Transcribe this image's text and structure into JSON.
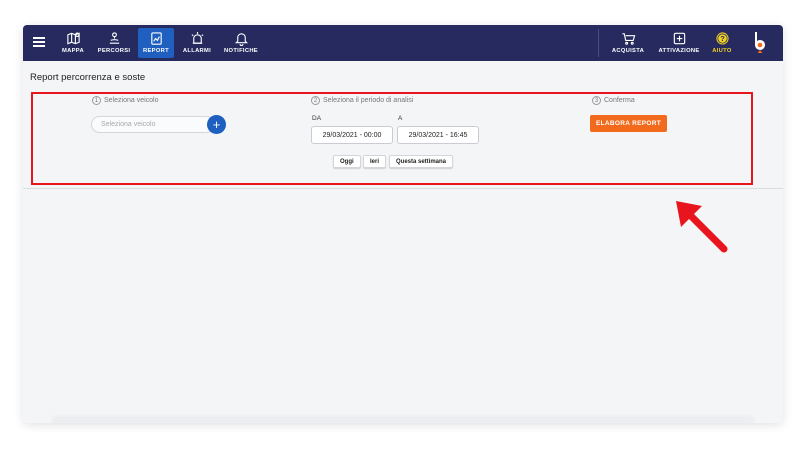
{
  "nav": {
    "items": [
      {
        "label": "MAPPA",
        "icon": "map-icon"
      },
      {
        "label": "PERCORSI",
        "icon": "route-icon"
      },
      {
        "label": "REPORT",
        "icon": "report-icon",
        "active": true
      },
      {
        "label": "ALLARMI",
        "icon": "alarm-icon"
      },
      {
        "label": "NOTIFICHE",
        "icon": "bell-icon"
      }
    ],
    "right": [
      {
        "label": "ACQUISTA",
        "icon": "cart-icon"
      },
      {
        "label": "ATTIVAZIONE",
        "icon": "plus-square-icon"
      },
      {
        "label": "AIUTO",
        "icon": "help-icon"
      }
    ]
  },
  "page": {
    "title": "Report percorrenza e soste"
  },
  "steps": {
    "vehicle": {
      "num": "1",
      "label": "Seleziona veicolo",
      "placeholder": "Seleziona veicolo",
      "add": "+"
    },
    "period": {
      "num": "2",
      "label": "Seleziona il periodo di analisi",
      "from_label": "DA",
      "from_value": "29/03/2021 - 00:00",
      "to_label": "A",
      "to_value": "29/03/2021 - 16:45",
      "quick": [
        "Oggi",
        "Ieri",
        "Questa settimana"
      ]
    },
    "confirm": {
      "num": "3",
      "label": "Conferma",
      "button": "ELABORA REPORT"
    }
  },
  "colors": {
    "navbar": "#262a5e",
    "active": "#1e5fbf",
    "accent": "#f26a1b",
    "highlight": "#e8141e",
    "help": "#f2d024"
  }
}
